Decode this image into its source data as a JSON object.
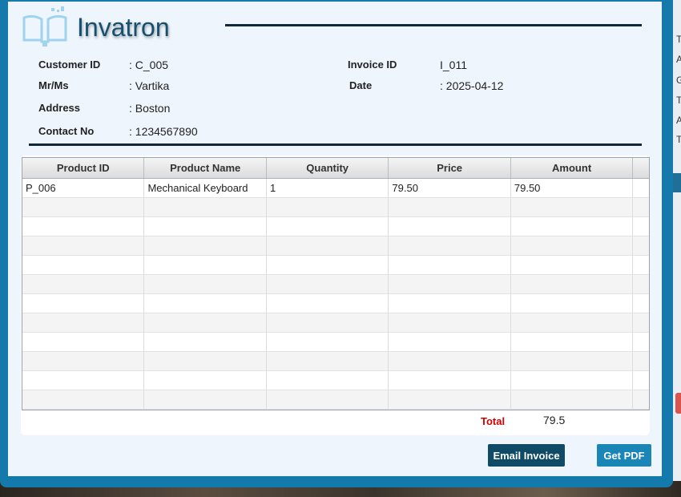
{
  "app": {
    "name": "Invatron"
  },
  "customer": {
    "id_label": "Customer ID",
    "id_value": ": C_005",
    "name_label": "Mr/Ms",
    "name_value": ": Vartika",
    "address_label": "Address",
    "address_value": ": Boston",
    "contact_label": "Contact No",
    "contact_value": ": 1234567890"
  },
  "invoice": {
    "id_label": "Invoice ID",
    "id_value": "I_011",
    "date_label": "Date",
    "date_value": ": 2025-04-12"
  },
  "table": {
    "columns": [
      "Product ID",
      "Product Name",
      "Quantity",
      "Price",
      "Amount"
    ],
    "rows": [
      [
        "P_006",
        "Mechanical Keyboard",
        "1",
        "79.50",
        "79.50"
      ],
      [
        "",
        "",
        "",
        "",
        ""
      ],
      [
        "",
        "",
        "",
        "",
        ""
      ],
      [
        "",
        "",
        "",
        "",
        ""
      ],
      [
        "",
        "",
        "",
        "",
        ""
      ],
      [
        "",
        "",
        "",
        "",
        ""
      ],
      [
        "",
        "",
        "",
        "",
        ""
      ],
      [
        "",
        "",
        "",
        "",
        ""
      ],
      [
        "",
        "",
        "",
        "",
        ""
      ],
      [
        "",
        "",
        "",
        "",
        ""
      ],
      [
        "",
        "",
        "",
        "",
        ""
      ],
      [
        "",
        "",
        "",
        "",
        ""
      ]
    ]
  },
  "total": {
    "label": "Total",
    "value": "79.5"
  },
  "buttons": {
    "email": "Email Invoice",
    "pdf": "Get PDF"
  },
  "background_window": {
    "letters": [
      "T",
      "A",
      "G",
      "T",
      "A",
      "T"
    ]
  },
  "colors": {
    "frame": "#1479ab",
    "panel": "#eef5fc",
    "brand_text": "#17506f",
    "total_label": "#d00000",
    "email_button": "#0f4a66",
    "pdf_button": "#1a86b8"
  }
}
